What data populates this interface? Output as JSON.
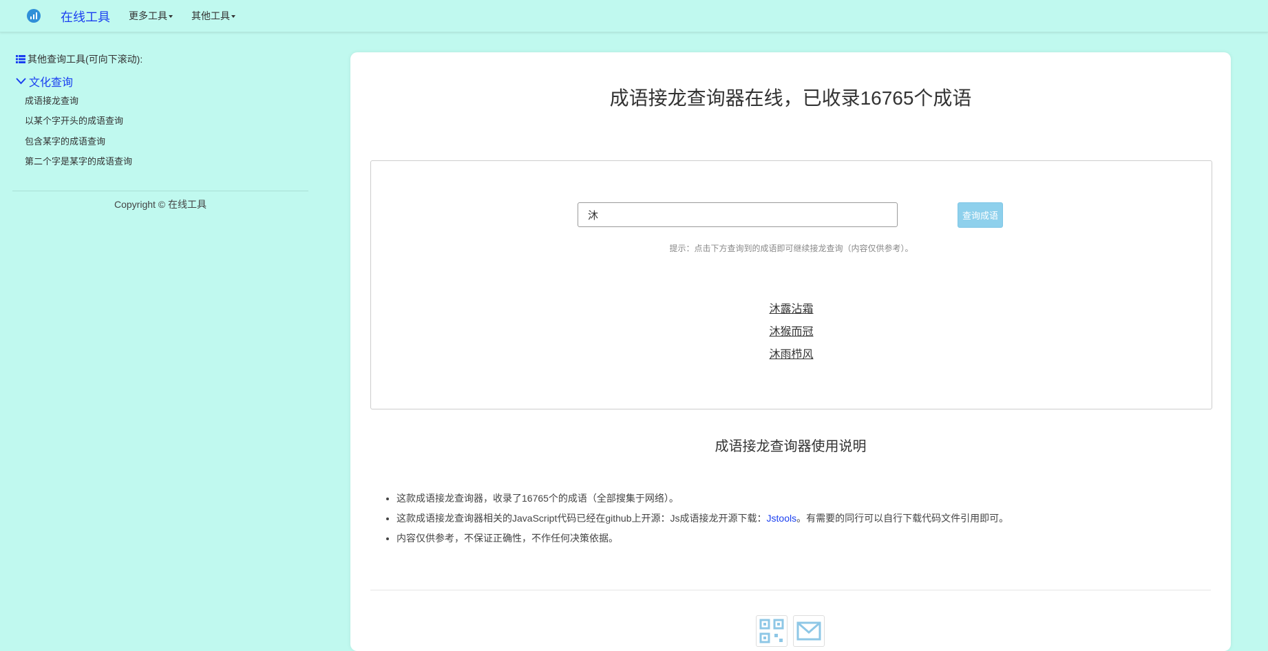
{
  "nav": {
    "brand": "在线工具",
    "menu_more": "更多工具",
    "menu_other": "其他工具"
  },
  "sidebar": {
    "heading": "其他查询工具(可向下滚动):",
    "section_title": "文化查询",
    "items": [
      {
        "label": "成语接龙查询"
      },
      {
        "label": "以某个字开头的成语查询"
      },
      {
        "label": "包含某字的成语查询"
      },
      {
        "label": "第二个字是某字的成语查询"
      }
    ],
    "copyright": "Copyright © 在线工具"
  },
  "main": {
    "title": "成语接龙查询器在线，已收录16765个成语",
    "search": {
      "value": "沐",
      "button_label": "查询成语"
    },
    "hint": "提示：点击下方查询到的成语即可继续接龙查询（内容仅供参考）。",
    "results": [
      "沐露沾霜",
      "沐猴而冠",
      "沐雨栉风"
    ],
    "usage_title": "成语接龙查询器使用说明",
    "notes": {
      "item1": "这款成语接龙查询器，收录了16765个的成语（全部搜集于网络）。",
      "item2_prefix": "这款成语接龙查询器相关的JavaScript代码已经在github上开源：Js成语接龙开源下载：",
      "item2_link": "Jstools",
      "item2_suffix": "。有需要的同行可以自行下载代码文件引用即可。",
      "item3": "内容仅供参考，不保证正确性，不作任何决策依据。"
    }
  },
  "colors": {
    "background": "#c0f9ef",
    "link_blue": "#1a3ff0",
    "button": "#8ed0ec"
  },
  "icons": {
    "logo": "chart-logo-icon",
    "list": "list-icon",
    "chevron": "chevron-down-icon",
    "qr": "qr-code-icon",
    "mail": "mail-icon"
  }
}
